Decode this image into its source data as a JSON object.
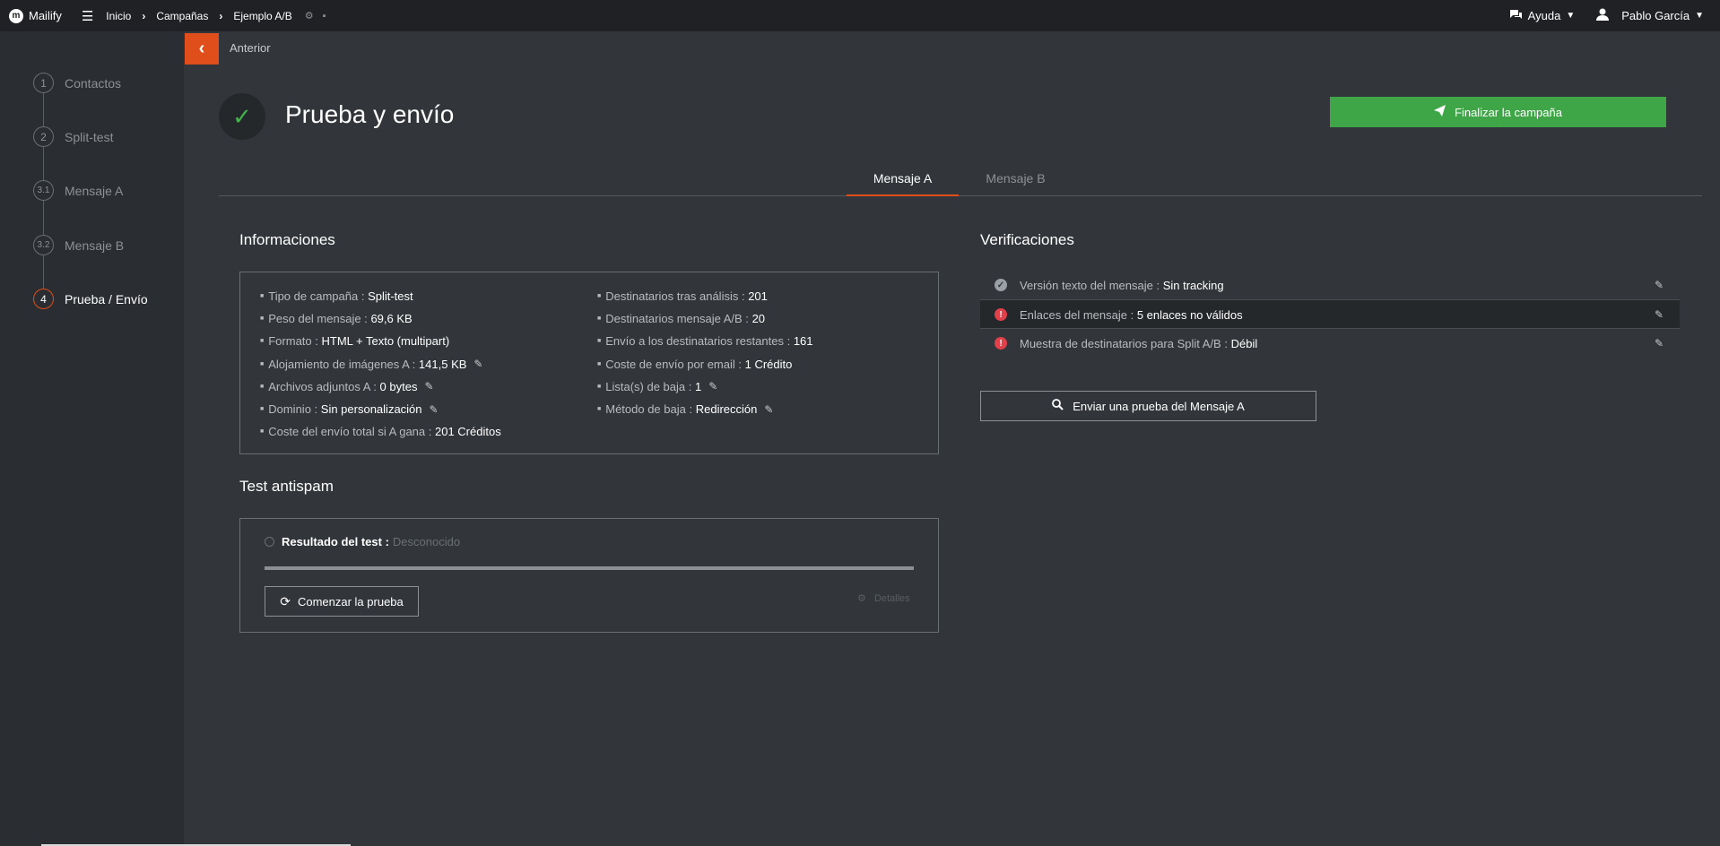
{
  "topbar": {
    "brand": "Mailify",
    "brand_logo": "m",
    "breadcrumbs": [
      "Inicio",
      "Campañas",
      "Ejemplo A/B"
    ],
    "help_label": "Ayuda",
    "user_name": "Pablo García"
  },
  "sidebar": {
    "steps": [
      {
        "number": "1",
        "label": "Contactos"
      },
      {
        "number": "2",
        "label": "Split-test"
      },
      {
        "number": "3.1",
        "label": "Mensaje A"
      },
      {
        "number": "3.2",
        "label": "Mensaje B"
      },
      {
        "number": "4",
        "label": "Prueba / Envío"
      }
    ],
    "active_step": 4
  },
  "back_label": "Anterior",
  "page_title": "Prueba y envío",
  "finish_button": "Finalizar la campaña",
  "tabs": [
    {
      "label": "Mensaje A",
      "active": true
    },
    {
      "label": "Mensaje B",
      "active": false
    }
  ],
  "info": {
    "title": "Informaciones",
    "left": [
      {
        "label": "Tipo de campaña :",
        "value": "Split-test",
        "editable": false
      },
      {
        "label": "Peso del mensaje :",
        "value": "69,6 KB",
        "editable": false
      },
      {
        "label": "Formato :",
        "value": "HTML + Texto (multipart)",
        "editable": false
      },
      {
        "label": "Alojamiento de imágenes A :",
        "value": "141,5 KB",
        "editable": true
      },
      {
        "label": "Archivos adjuntos A :",
        "value": "0 bytes",
        "editable": true
      },
      {
        "label": "Dominio :",
        "value": "Sin personalización",
        "editable": true
      },
      {
        "label": "Coste del envío total si A gana :",
        "value": "201 Créditos",
        "editable": false
      }
    ],
    "right": [
      {
        "label": "Destinatarios tras análisis :",
        "value": "201",
        "editable": false
      },
      {
        "label": "Destinatarios mensaje A/B :",
        "value": "20",
        "editable": false
      },
      {
        "label": "Envío a los destinatarios restantes :",
        "value": "161",
        "editable": false
      },
      {
        "label": "Coste de envío por email :",
        "value": "1 Crédito",
        "editable": false
      },
      {
        "label": "Lista(s) de baja :",
        "value": "1",
        "editable": true
      },
      {
        "label": "Método de baja :",
        "value": "Redirección",
        "editable": true
      }
    ]
  },
  "antispam": {
    "title": "Test antispam",
    "result_label": "Resultado del test :",
    "result_value": "Desconocido",
    "progress": 0,
    "start_button": "Comenzar la prueba",
    "details_label": "Detalles"
  },
  "verifications": {
    "title": "Verificaciones",
    "items": [
      {
        "label": "Versión texto del mensaje :",
        "value": "Sin tracking",
        "status": "ok"
      },
      {
        "label": "Enlaces del mensaje :",
        "value": "5 enlaces no válidos",
        "status": "error"
      },
      {
        "label": "Muestra de destinatarios para Split A/B :",
        "value": "Débil",
        "status": "error"
      }
    ],
    "send_test_button": "Enviar una prueba del Mensaje A"
  },
  "colors": {
    "accent": "#e04e1b",
    "success": "#3fa648",
    "error": "#e0404a",
    "background": "#32363a",
    "sidebar": "#2a2d31",
    "topbar": "#1f2124"
  },
  "icons": {
    "menu": "hamburger-icon",
    "help": "chat-icon",
    "user": "user-icon",
    "edit": "pencil-icon",
    "search": "search-icon",
    "refresh": "refresh-icon",
    "send": "paper-plane-icon"
  }
}
